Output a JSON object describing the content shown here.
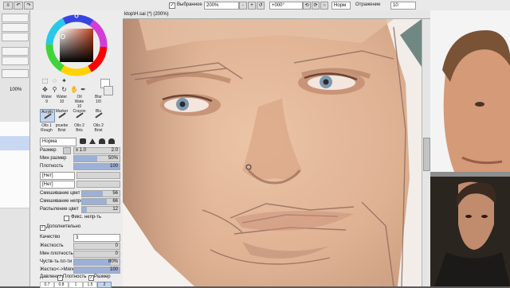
{
  "toolbar": {
    "selection_label": "Выбранное",
    "zoom": "200%",
    "rotation": "+000°",
    "blend_mode": "Норм",
    "stabilizer_label": "Отражение",
    "stabilizer_value": "10"
  },
  "canvas": {
    "title": "ktop\\H.sai (*) (200%)"
  },
  "tools": {
    "row1": [
      "Water",
      "Water",
      "Oil Wate",
      "Blur"
    ],
    "row1_sizes": [
      "9",
      "10",
      "10",
      "1/0"
    ],
    "row2": [
      "Acrylic",
      "Marker",
      "Crayon",
      "Blu"
    ],
    "row3": [
      "Oils 1 Rough",
      "pruebe Brist",
      "Oils 2 Bris",
      "Oils 2 Brist"
    ]
  },
  "brush": {
    "shape_label": "Норма",
    "size_label": "Размер",
    "size_multiplier": "x 1.0",
    "size_value": "2.0",
    "min_size_label": "Мин размер",
    "min_size_value": "50%",
    "density_label": "Плотность",
    "density_value": "100",
    "texture1": "[Нет]",
    "texture2": "[Нет]",
    "blend_color_label": "Смешивание цвет",
    "blend_color_value": "56",
    "dilute_label": "Смешивание непро",
    "dilute_value": "66",
    "persistence_label": "Распыление цвет",
    "persistence_value": "12",
    "fix_label": "Фикс. непр-ть",
    "advanced_label": "Дополнительно",
    "quality_label": "Качество",
    "quality_value": "3",
    "hardness_label": "Жесткость",
    "hardness_value": "0",
    "min_density_label": "Мин плотность",
    "min_density_value": "0",
    "pressure_label": "Чуств-ть пл-ти",
    "pressure_value": "80%",
    "hard_soft_label": "Жестко<->Мягко",
    "hard_soft_value": "100",
    "pressure_opts_label": "Давление",
    "pressure_opt1": "Плотность",
    "pressure_opt2": "Размер",
    "size_presets": [
      "0.7",
      "0.8",
      "1",
      "1.5",
      "2"
    ]
  },
  "left_strip": {
    "label": "100%"
  },
  "colors": {
    "accent": "#7d92b8",
    "skin": "#e3b89b",
    "canvas_bg": "#d9d9d9"
  }
}
